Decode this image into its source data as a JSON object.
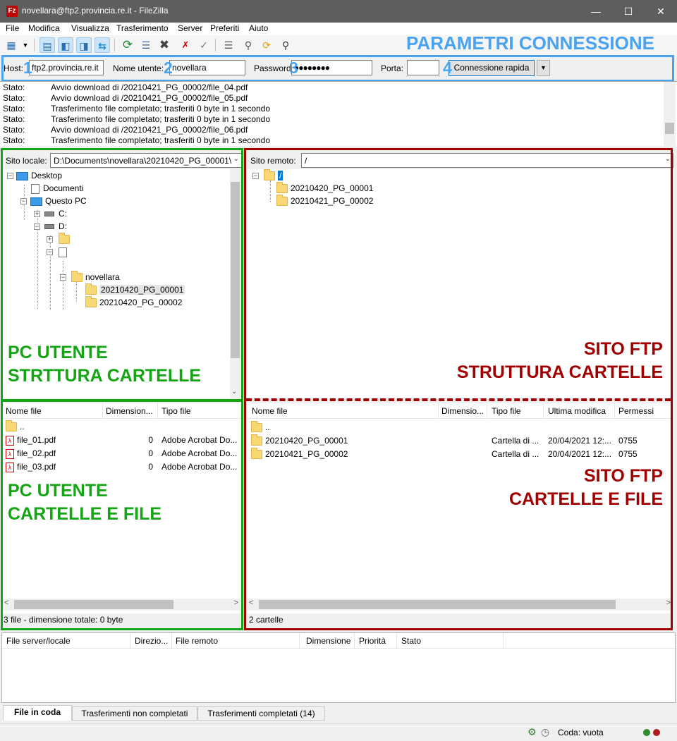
{
  "window": {
    "title": "novellara@ftp2.provincia.re.it - FileZilla",
    "app_icon": "Fz"
  },
  "menu": [
    "File",
    "Modifica",
    "Visualizza",
    "Trasferimento",
    "Server",
    "Preferiti",
    "Aiuto"
  ],
  "quickconnect": {
    "host_label": "Host:",
    "host_value": "ftp2.provincia.re.it",
    "user_label": "Nome utente:",
    "user_value": "novellara",
    "password_label": "Password:",
    "password_value": "●●●●●●●●",
    "port_label": "Porta:",
    "port_value": "",
    "connect_label": "Connessione rapida",
    "markers": [
      "1",
      "2",
      "3",
      "4"
    ]
  },
  "annotations": {
    "connection": "PARAMETRI CONNESSIONE",
    "local_tree": [
      "PC UTENTE",
      "STRTTURA CARTELLE"
    ],
    "local_files": [
      "PC UTENTE",
      "CARTELLE E FILE"
    ],
    "remote_tree": [
      "SITO FTP",
      "STRUTTURA CARTELLE"
    ],
    "remote_files": [
      "SITO FTP",
      "CARTELLE E FILE"
    ],
    "colors": {
      "blue": "#4aa3f0",
      "green": "#13a513",
      "red": "#a00000"
    }
  },
  "log": [
    {
      "k": "Stato:",
      "v": "Avvio download di /20210421_PG_00002/file_04.pdf"
    },
    {
      "k": "Stato:",
      "v": "Avvio download di /20210421_PG_00002/file_05.pdf"
    },
    {
      "k": "Stato:",
      "v": "Trasferimento file completato; trasferiti 0 byte in 1 secondo"
    },
    {
      "k": "Stato:",
      "v": "Trasferimento file completato; trasferiti 0 byte in 1 secondo"
    },
    {
      "k": "Stato:",
      "v": "Avvio download di /20210421_PG_00002/file_06.pdf"
    },
    {
      "k": "Stato:",
      "v": "Trasferimento file completato; trasferiti 0 byte in 1 secondo"
    }
  ],
  "local": {
    "site_label": "Sito locale:",
    "site_path": "D:\\Documents\\novellara\\20210420_PG_00001\\",
    "tree": {
      "desktop": "Desktop",
      "documenti": "Documenti",
      "questo_pc": "Questo PC",
      "c": "C:",
      "d": "D:",
      "novellara": "novellara",
      "f1": "20210420_PG_00001",
      "f2": "20210420_PG_00002"
    },
    "columns": [
      "Nome file",
      "Dimension...",
      "Tipo file"
    ],
    "files": [
      {
        "name": "..",
        "size": "",
        "type": ""
      },
      {
        "name": "file_01.pdf",
        "size": "0",
        "type": "Adobe Acrobat Do..."
      },
      {
        "name": "file_02.pdf",
        "size": "0",
        "type": "Adobe Acrobat Do..."
      },
      {
        "name": "file_03.pdf",
        "size": "0",
        "type": "Adobe Acrobat Do..."
      }
    ],
    "status": "3 file - dimensione totale: 0 byte"
  },
  "remote": {
    "site_label": "Sito remoto:",
    "site_path": "/",
    "tree": {
      "root": "/",
      "f1": "20210420_PG_00001",
      "f2": "20210421_PG_00002"
    },
    "columns": [
      "Nome file",
      "Dimensio...",
      "Tipo file",
      "Ultima modifica",
      "Permessi"
    ],
    "files": [
      {
        "name": "..",
        "size": "",
        "type": "",
        "modified": "",
        "perm": ""
      },
      {
        "name": "20210420_PG_00001",
        "size": "",
        "type": "Cartella di ...",
        "modified": "20/04/2021 12:...",
        "perm": "0755"
      },
      {
        "name": "20210421_PG_00002",
        "size": "",
        "type": "Cartella di ...",
        "modified": "20/04/2021 12:...",
        "perm": "0755"
      }
    ],
    "status": "2 cartelle"
  },
  "queue": {
    "columns": [
      "File server/locale",
      "Direzio...",
      "File remoto",
      "Dimensione",
      "Priorità",
      "Stato"
    ],
    "tabs": [
      "File in coda",
      "Trasferimenti non completati",
      "Trasferimenti completati (14)"
    ],
    "status": "Coda: vuota"
  }
}
